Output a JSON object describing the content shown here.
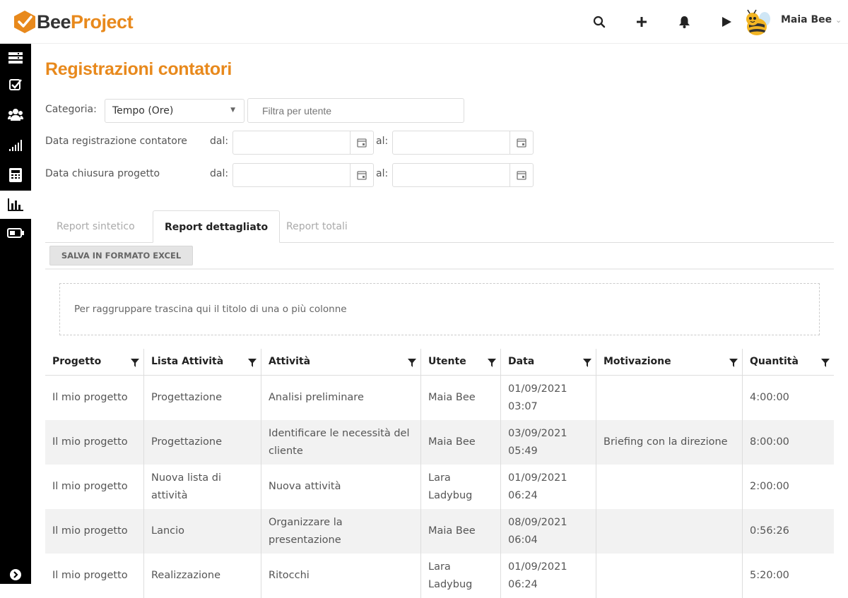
{
  "app": {
    "brand_part1": "Bee",
    "brand_part2": "Project"
  },
  "header": {
    "icons": [
      "search-icon",
      "plus-icon",
      "bell-icon",
      "play-icon"
    ],
    "user_name": "Maia Bee"
  },
  "sidebar": {
    "items": [
      "dashboard-icon",
      "tasks-icon",
      "team-icon",
      "stats-icon",
      "calculator-icon",
      "reports-icon",
      "battery-icon"
    ],
    "active_index": 5
  },
  "page": {
    "title": "Registrazioni contatori"
  },
  "filters": {
    "category_label": "Categoria:",
    "category_value": "Tempo (Ore)",
    "user_filter_placeholder": "Filtra per utente",
    "reg_date_label": "Data registrazione contatore",
    "close_date_label": "Data chiusura progetto",
    "from_label": "dal:",
    "to_label": "al:"
  },
  "tabs": [
    "Report sintetico",
    "Report dettagliato",
    "Report totali"
  ],
  "active_tab": 1,
  "excel_button": "SALVA IN FORMATO EXCEL",
  "group_hint": "Per raggruppare trascina qui il titolo di una o più colonne",
  "table": {
    "columns": [
      "Progetto",
      "Lista Attività",
      "Attività",
      "Utente",
      "Data",
      "Motivazione",
      "Quantità"
    ],
    "rows": [
      {
        "progetto": "Il mio progetto",
        "lista": "Progettazione",
        "attivita": "Analisi preliminare",
        "utente": "Maia Bee",
        "data_d": "01/09/2021",
        "data_t": "03:07",
        "motivazione": "",
        "quantita": "4:00:00"
      },
      {
        "progetto": "Il mio progetto",
        "lista": "Progettazione",
        "attivita": "Identificare le necessità del cliente",
        "utente": "Maia Bee",
        "data_d": "03/09/2021",
        "data_t": "05:49",
        "motivazione": "Briefing con la direzione",
        "quantita": "8:00:00"
      },
      {
        "progetto": "Il mio progetto",
        "lista": "Nuova lista di attività",
        "attivita": "Nuova attività",
        "utente": "Lara Ladybug",
        "data_d": "01/09/2021",
        "data_t": "06:24",
        "motivazione": "",
        "quantita": "2:00:00"
      },
      {
        "progetto": "Il mio progetto",
        "lista": "Lancio",
        "attivita": "Organizzare la presentazione",
        "utente": "Maia Bee",
        "data_d": "08/09/2021",
        "data_t": "06:04",
        "motivazione": "",
        "quantita": "0:56:26"
      },
      {
        "progetto": "Il mio progetto",
        "lista": "Realizzazione",
        "attivita": "Ritocchi",
        "utente": "Lara Ladybug",
        "data_d": "01/09/2021",
        "data_t": "06:24",
        "motivazione": "",
        "quantita": "5:20:00"
      }
    ]
  },
  "colors": {
    "accent": "#e8891c",
    "sidebar_bg": "#000000",
    "alt_row": "#f2f2f2"
  }
}
